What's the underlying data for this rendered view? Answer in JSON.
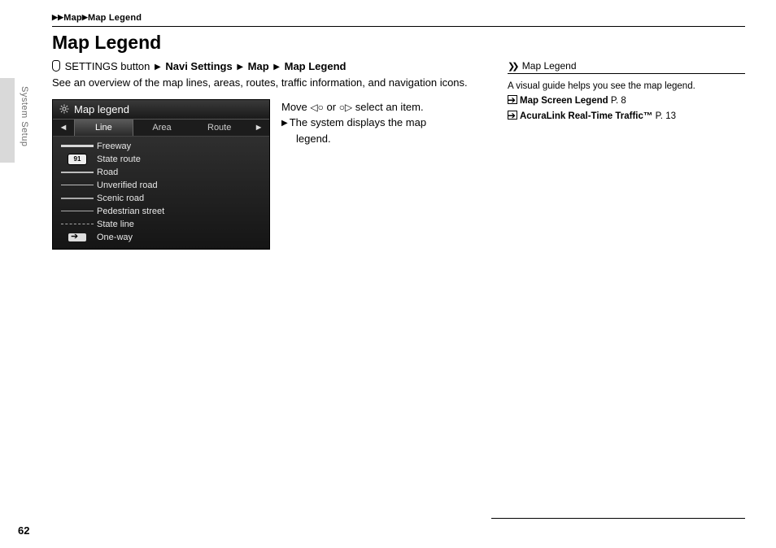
{
  "breadcrumb": {
    "a": "Map",
    "b": "Map Legend"
  },
  "title": "Map Legend",
  "side_section": "System Setup",
  "path": {
    "btn": "SETTINGS button",
    "p1": "Navi Settings",
    "p2": "Map",
    "p3": "Map Legend"
  },
  "intro": "See an overview of the map lines, areas, routes, traffic information, and navigation icons.",
  "screenshot": {
    "title": "Map legend",
    "tabs": {
      "t1": "Line",
      "t2": "Area",
      "t3": "Route"
    },
    "rows": [
      {
        "label": "Freeway",
        "color": "#d8d8d8",
        "style": "solid",
        "w": 3,
        "badge": ""
      },
      {
        "label": "State route",
        "color": "#d8d8d8",
        "style": "solid",
        "w": 3,
        "badge": "91"
      },
      {
        "label": "Road",
        "color": "#bdbdbd",
        "style": "solid",
        "w": 2,
        "badge": ""
      },
      {
        "label": "Unverified road",
        "color": "#bdbdbd",
        "style": "solid",
        "w": 1,
        "badge": ""
      },
      {
        "label": "Scenic road",
        "color": "#a9a9a9",
        "style": "solid",
        "w": 2,
        "badge": ""
      },
      {
        "label": "Pedestrian street",
        "color": "#a9a9a9",
        "style": "solid",
        "w": 1,
        "badge": ""
      },
      {
        "label": "State line",
        "color": "#a9a9a9",
        "style": "dashed",
        "w": 1,
        "badge": ""
      },
      {
        "label": "One-way",
        "color": "#d8d8d8",
        "style": "solid",
        "w": 1,
        "badge": "oneway"
      }
    ]
  },
  "instr": {
    "l1a": "Move ",
    "l1b": " or ",
    "l1c": " select an item.",
    "l2": "The system displays the map legend."
  },
  "note": {
    "head": "Map Legend",
    "t1": "A visual guide helps you see the map legend.",
    "r1": "Map Screen Legend",
    "p1": "P. 8",
    "r2": "AcuraLink Real-Time Traffic™",
    "p2": "P. 13"
  },
  "page": "62"
}
